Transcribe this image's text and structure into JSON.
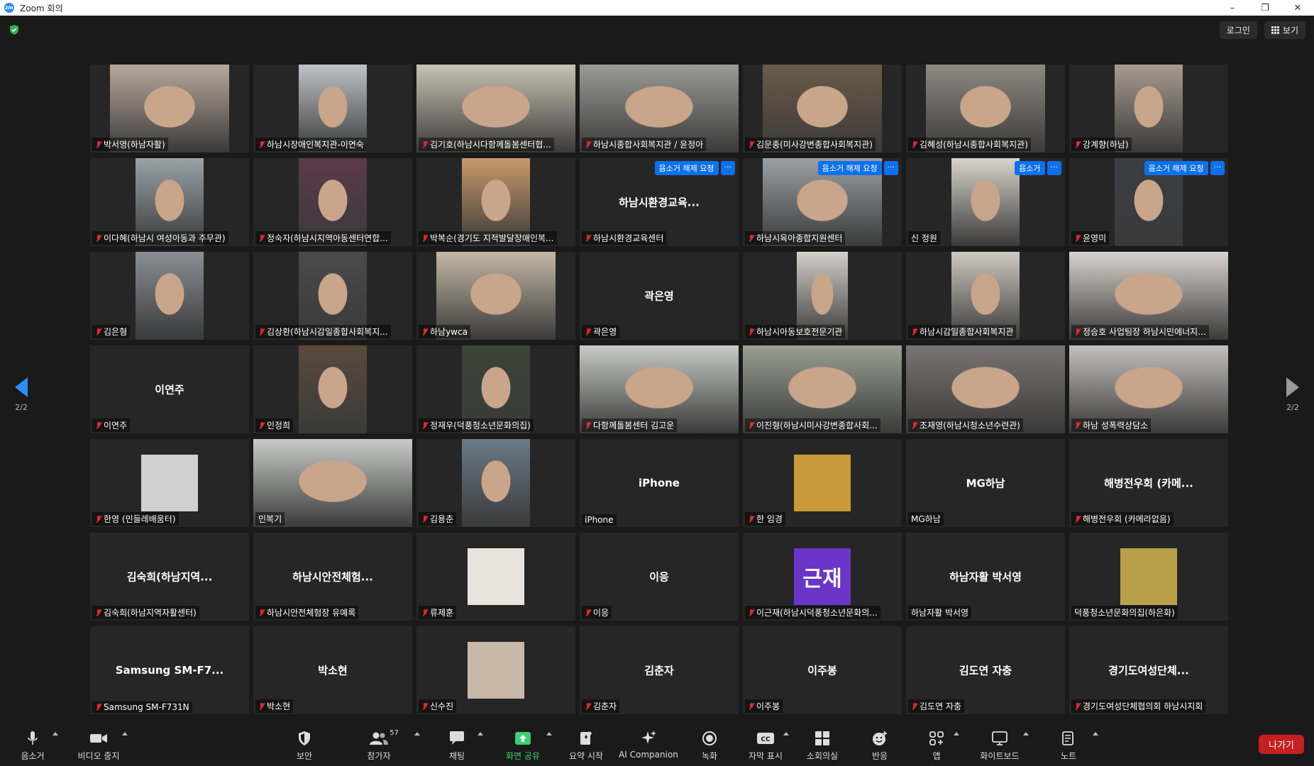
{
  "window": {
    "title": "Zoom 회의",
    "logo": "zm"
  },
  "topbar": {
    "login_label": "로그인",
    "view_label": "보기"
  },
  "pages": {
    "left": "2/2",
    "right": "2/2"
  },
  "tiles": [
    {
      "label": "박서영(하남자활)",
      "muted": true,
      "video": true,
      "bg": "#b9a89a",
      "shape": "wide"
    },
    {
      "label": "하남시장애인복지관-이연숙",
      "muted": true,
      "video": true,
      "bg": "#bfc3c7",
      "shape": "mid"
    },
    {
      "label": "김기호(하남시다함께돌봄센터협...",
      "muted": true,
      "video": true,
      "bg": "#c8c4b2",
      "shape": "full"
    },
    {
      "label": "하남시종합사회복지관 / 윤정아",
      "muted": true,
      "video": true,
      "bg": "#9a9a98",
      "shape": "full"
    },
    {
      "label": "김문종(미사강변종합사회복지관)",
      "muted": true,
      "video": true,
      "bg": "#6b5a48",
      "shape": "wide"
    },
    {
      "label": "김혜성(하남시종합사회복지관)",
      "muted": true,
      "video": true,
      "bg": "#8c8a80",
      "shape": "wide"
    },
    {
      "label": "강계향(하남)",
      "muted": true,
      "video": true,
      "bg": "#a89c90",
      "shape": "mid"
    },
    {
      "label": "이다혜(하남시 여성아동과 주무관)",
      "muted": true,
      "video": true,
      "bg": "#9aa3a8",
      "shape": "mid"
    },
    {
      "label": "정숙자(하남시지역아동센터연합...",
      "muted": true,
      "video": true,
      "bg": "#5c3a4a",
      "shape": "mid"
    },
    {
      "label": "박복순(경기도 지적발달장애인복...",
      "muted": true,
      "video": true,
      "bg": "#c89a6a",
      "shape": "mid"
    },
    {
      "label": "하남시환경교육센터",
      "muted": true,
      "video": false,
      "center": "하남시환경교육...",
      "request": true
    },
    {
      "label": "하남시육아종합지원센터",
      "muted": true,
      "video": true,
      "bg": "#9aa0a4",
      "shape": "wide",
      "request": true
    },
    {
      "label": "신 정원",
      "muted": false,
      "video": true,
      "bg": "#d8d4cc",
      "shape": "mid",
      "request_short": true
    },
    {
      "label": "윤영미",
      "muted": true,
      "video": true,
      "bg": "#3a3e44",
      "shape": "mid",
      "request": true
    },
    {
      "label": "김은형",
      "muted": true,
      "video": true,
      "bg": "#8a8e96",
      "shape": "mid"
    },
    {
      "label": "김상환(하남시감일종합사회복지...",
      "muted": true,
      "video": true,
      "bg": "#4a4a4a",
      "shape": "mid"
    },
    {
      "label": "하남ywca",
      "muted": true,
      "video": true,
      "bg": "#c4b8a4",
      "shape": "wide"
    },
    {
      "label": "곽은영",
      "muted": true,
      "video": false,
      "center": "곽은영"
    },
    {
      "label": "하남시아동보호전문기관",
      "muted": true,
      "video": true,
      "bg": "#d4d0c8",
      "shape": "narrow"
    },
    {
      "label": "하남시감일종합사회복지관",
      "muted": true,
      "video": true,
      "bg": "#cfcac0",
      "shape": "mid"
    },
    {
      "label": "정승호 사업팀장 하남시민에너지...",
      "muted": true,
      "video": true,
      "bg": "#d8d2cc",
      "shape": "full"
    },
    {
      "label": "이연주",
      "muted": true,
      "video": false,
      "center": "이연주"
    },
    {
      "label": "인정희",
      "muted": true,
      "video": true,
      "bg": "#5a4a3c",
      "shape": "mid"
    },
    {
      "label": "정재우(덕풍청소년문화의집)",
      "muted": true,
      "video": true,
      "bg": "#3a4436",
      "shape": "mid"
    },
    {
      "label": "다함께돌봄센터 김고운",
      "muted": true,
      "video": true,
      "bg": "#c8ccc4",
      "shape": "full"
    },
    {
      "label": "이진형(하남시미사강변종합사회...",
      "muted": true,
      "video": true,
      "bg": "#9aa092",
      "shape": "full"
    },
    {
      "label": "조재영(하남시청소년수련관)",
      "muted": true,
      "video": true,
      "bg": "#7a7470",
      "shape": "full"
    },
    {
      "label": "하남 성폭력상담소",
      "muted": true,
      "video": true,
      "bg": "#c4c0bc",
      "shape": "full"
    },
    {
      "label": "한영 (민들레배움터)",
      "muted": true,
      "video": false,
      "avatar": true,
      "avatar_color": "#d0d0d0"
    },
    {
      "label": "민복기",
      "muted": false,
      "video": true,
      "bg": "#c8ccc8",
      "shape": "full"
    },
    {
      "label": "김용춘",
      "muted": true,
      "video": true,
      "bg": "#6a7a88",
      "shape": "mid"
    },
    {
      "label": "iPhone",
      "muted": false,
      "video": false,
      "center": "iPhone"
    },
    {
      "label": "한 임경",
      "muted": true,
      "video": false,
      "avatar": true,
      "avatar_color": "#c89a3a"
    },
    {
      "label": "MG하남",
      "muted": false,
      "video": false,
      "center": "MG하남"
    },
    {
      "label": "해병전우회 (카메라없음)",
      "muted": true,
      "video": false,
      "center": "해병전우회 (카메..."
    },
    {
      "label": "김숙희(하남지역자활센터)",
      "muted": true,
      "video": false,
      "center": "김숙희(하남지역..."
    },
    {
      "label": "하남시안전체험장 유예록",
      "muted": true,
      "video": false,
      "center": "하남시안전체험..."
    },
    {
      "label": "류제훈",
      "muted": true,
      "video": false,
      "avatar": true,
      "avatar_color": "#e8e4dc"
    },
    {
      "label": "이응",
      "muted": true,
      "video": false,
      "center": "이응"
    },
    {
      "label": "이근재(하남시덕풍청소년문화의...",
      "muted": true,
      "video": false,
      "avatar": true,
      "avatar_color": "#6a35c8",
      "avatar_text": "근재"
    },
    {
      "label": "하남자활 박서영",
      "muted": false,
      "video": false,
      "center": "하남자활 박서영"
    },
    {
      "label": "덕풍청소년문화의집(하은화)",
      "muted": false,
      "video": false,
      "avatar": true,
      "avatar_color": "#b8a04a"
    },
    {
      "label": "Samsung SM-F731N",
      "muted": true,
      "video": false,
      "center": "Samsung  SM-F7..."
    },
    {
      "label": "박소현",
      "muted": true,
      "video": false,
      "center": "박소현"
    },
    {
      "label": "신수진",
      "muted": true,
      "video": false,
      "avatar": true,
      "avatar_color": "#c8b8a8"
    },
    {
      "label": "김춘자",
      "muted": true,
      "video": false,
      "center": "김춘자"
    },
    {
      "label": "이주봉",
      "muted": true,
      "video": false,
      "center": "이주봉"
    },
    {
      "label": "김도연 자충",
      "muted": true,
      "video": false,
      "center": "김도연 자충"
    },
    {
      "label": "경기도여성단체협의회 하남시지회",
      "muted": true,
      "video": false,
      "center": "경기도여성단체..."
    }
  ],
  "unmute_request": {
    "label": "음소거 해제 요청",
    "short_label": "음소거",
    "more": "···"
  },
  "toolbar": {
    "mute": "음소거",
    "video": "비디오 중지",
    "security": "보안",
    "participants": "참가자",
    "participants_count": "57",
    "chat": "채팅",
    "share": "화면 공유",
    "summary": "요약 시작",
    "ai": "AI Companion",
    "record": "녹화",
    "captions": "자막 표시",
    "breakout": "소회의실",
    "reactions": "반응",
    "apps": "앱",
    "whiteboard": "화이트보드",
    "notes": "노트",
    "leave": "나가기"
  },
  "colors": {
    "accent": "#2d8cff",
    "share_green": "#3bd16f",
    "leave_red": "#c51f1f",
    "request_blue": "#0e71eb"
  }
}
